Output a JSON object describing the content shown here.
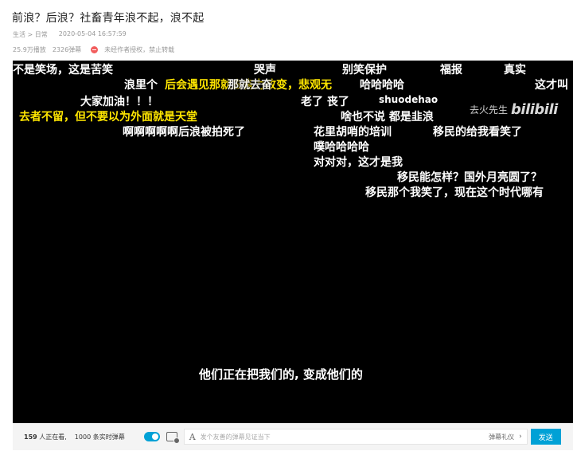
{
  "title": "前浪？后浪？社畜青年浪不起，浪不起",
  "meta": {
    "category": "生活 > 日常",
    "datetime": "2020-05-04 16:57:59",
    "plays": "25.9万播放",
    "danmaku_count": "2326弹幕",
    "copyright": "未经作者授权，禁止转载"
  },
  "player": {
    "watermark_text": "去火先生",
    "watermark_logo": "bilibili",
    "subtitle": "他们正在把我们的, 变成他们的",
    "danmaku": [
      {
        "text": "不是笑场，这是苦笑",
        "color": "white"
      },
      {
        "text": "哭声",
        "color": "white"
      },
      {
        "text": "别笑保护",
        "color": "white"
      },
      {
        "text": "福报",
        "color": "white"
      },
      {
        "text": "真实",
        "color": "white"
      },
      {
        "text": "浪里个",
        "color": "white"
      },
      {
        "text": "后会遇见那就去奋力改变，悲观无",
        "color": "yellow"
      },
      {
        "text": "那就去奋",
        "color": "white"
      },
      {
        "text": "哈哈哈哈",
        "color": "white"
      },
      {
        "text": "这才叫",
        "color": "white"
      },
      {
        "text": "大家加油！！！",
        "color": "white"
      },
      {
        "text": "老了 丧了",
        "color": "white"
      },
      {
        "text": "shuodehao",
        "color": "white"
      },
      {
        "text": "去者不留，但不要以为外面就是天堂",
        "color": "yellow"
      },
      {
        "text": "啥也不说 都是韭浪",
        "color": "white"
      },
      {
        "text": "啊啊啊啊啊后浪被拍死了",
        "color": "white"
      },
      {
        "text": "花里胡哨的培训",
        "color": "white"
      },
      {
        "text": "移民的给我看笑了",
        "color": "white"
      },
      {
        "text": "噗哈哈哈哈",
        "color": "white"
      },
      {
        "text": "对对对，这才是我",
        "color": "white"
      },
      {
        "text": "移民能怎样？国外月亮圆了？",
        "color": "white"
      },
      {
        "text": "移民那个我笑了，现在这个时代哪有",
        "color": "white"
      }
    ]
  },
  "bar": {
    "viewers_num": "159",
    "viewers_label": " 人正在看,",
    "live_count": "1000 条实时弹幕",
    "font_icon": "A",
    "input_placeholder": "发个友善的弹幕见证当下",
    "etiquette": "弹幕礼仪",
    "chevron": "›",
    "send": "发送"
  },
  "colors": {
    "accent": "#00a1d6",
    "danmaku_yellow": "#ffe600",
    "player_bg": "#000000"
  }
}
